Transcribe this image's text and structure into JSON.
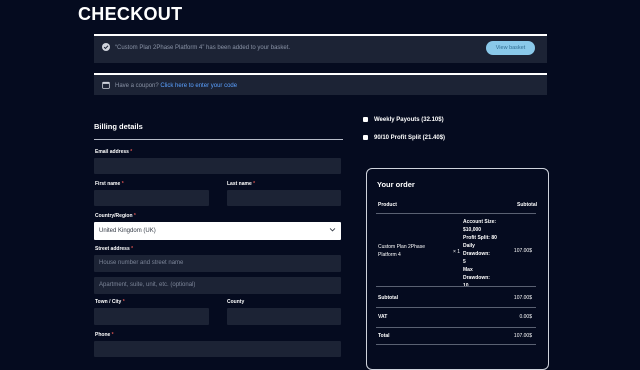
{
  "page": {
    "title": "CHECKOUT"
  },
  "notice": {
    "added_message": "“Custom Plan 2Phase Platform 4” has been added to your basket.",
    "view_basket_label": "View basket"
  },
  "coupon": {
    "prompt": "Have a coupon?",
    "link_label": "Click here to enter your code"
  },
  "billing": {
    "heading": "Billing details",
    "email_label": "Email address",
    "first_name_label": "First name",
    "last_name_label": "Last name",
    "country_label": "Country/Region",
    "country_value": "United Kingdom (UK)",
    "street_label": "Street address",
    "street_placeholder": "House number and street name",
    "apartment_placeholder": "Apartment, suite, unit, etc. (optional)",
    "town_label": "Town / City",
    "county_label": "County",
    "phone_label": "Phone",
    "required_mark": "*"
  },
  "addons": [
    {
      "label": "Weekly Payouts (32.10$)"
    },
    {
      "label": "90/10 Profit Split (21.40$)"
    }
  ],
  "order": {
    "title": "Your order",
    "product_header": "Product",
    "subtotal_header": "Subtotal",
    "item_name_line1": "Custom Plan 2Phase",
    "item_name_line2": "Platform 4",
    "item_qty": "× 1",
    "item_details": [
      "Account Size:",
      "$10,000",
      "Profit Split: 80",
      "Daily",
      "Drawdown:",
      "5",
      "Max",
      "Drawdown:",
      "10"
    ],
    "item_price": "107.00$",
    "subtotal_label": "Subtotal",
    "subtotal_value": "107.00$",
    "vat_label": "VAT",
    "vat_value": "0.00$",
    "total_label": "Total",
    "total_value": "107.00$"
  }
}
